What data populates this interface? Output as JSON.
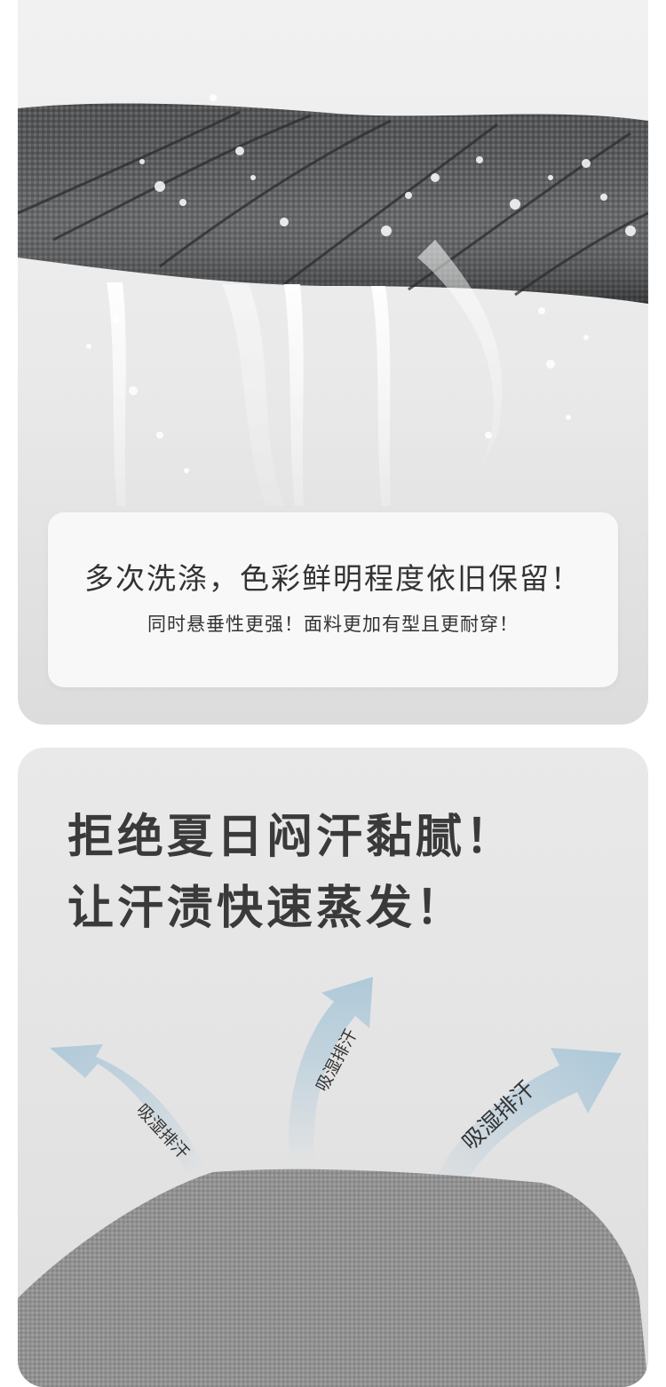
{
  "section_wash": {
    "card_title": "多次洗涤，色彩鲜明程度依旧保留！",
    "card_subtitle": "同时悬垂性更强！面料更加有型且更耐穿！"
  },
  "section_sweat": {
    "headline_line1": "拒绝夏日闷汗黏腻！",
    "headline_line2": "让汗渍快速蒸发！",
    "arrow_labels": [
      "吸湿排汗",
      "吸湿排汗",
      "吸湿排汗"
    ],
    "arrow_color": "#a9c6d8"
  },
  "colors": {
    "fabric_dark": "#4f5152",
    "fabric_gray": "#9a9a9a",
    "text": "#333333"
  }
}
